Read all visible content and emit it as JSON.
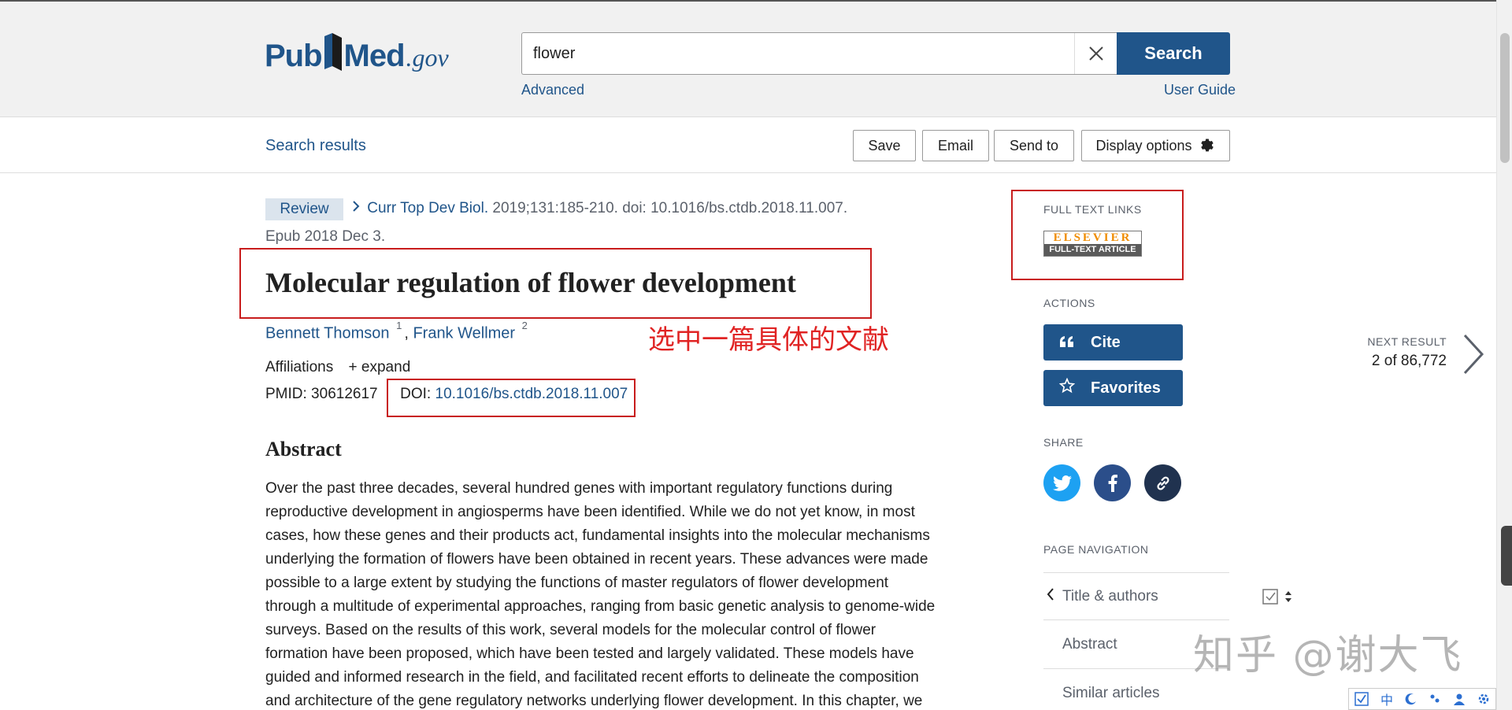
{
  "header": {
    "logo_text_pub": "Pub",
    "logo_text_med": "Med",
    "logo_text_gov": ".gov",
    "search_value": "flower",
    "search_button": "Search",
    "advanced_link": "Advanced",
    "user_guide_link": "User Guide"
  },
  "toolbar": {
    "search_results": "Search results",
    "save": "Save",
    "email": "Email",
    "send_to": "Send to",
    "display_options": "Display options"
  },
  "article": {
    "badge": "Review",
    "journal": "Curr Top Dev Biol.",
    "citation_rest": " 2019;131:185-210. doi: 10.1016/bs.ctdb.2018.11.007.",
    "epub": "Epub 2018 Dec 3.",
    "title": "Molecular regulation of flower development",
    "authors": [
      {
        "name": "Bennett Thomson",
        "aff": "1"
      },
      {
        "name": "Frank Wellmer",
        "aff": "2"
      }
    ],
    "affiliations_label": "Affiliations",
    "expand_label": "+ expand",
    "pmid_label": "PMID: 30612617",
    "doi_label": "DOI: ",
    "doi_value": "10.1016/bs.ctdb.2018.11.007",
    "abstract_heading": "Abstract",
    "abstract_lines": [
      "Over the past three decades, several hundred genes with important regulatory functions during",
      "reproductive development in angiosperms have been identified. While we do not yet know, in most",
      "cases, how these genes and their products act, fundamental insights into the molecular mechanisms",
      "underlying the formation of flowers have been obtained in recent years. These advances were made",
      "possible to a large extent by studying the functions of master regulators of flower development",
      "through a multitude of experimental approaches, ranging from basic genetic analysis to genome-wide",
      "surveys. Based on the results of this work, several models for the molecular control of flower",
      "formation have been proposed, which have been tested and largely validated. These models have",
      "guided and informed research in the field, and facilitated recent efforts to delineate the composition",
      "and architecture of the gene regulatory networks underlying flower development. In this chapter, we"
    ]
  },
  "annotation": "选中一篇具体的文献",
  "sidebar": {
    "full_text_links_label": "FULL TEXT LINKS",
    "elsevier_top": "ELSEVIER",
    "elsevier_bottom": "FULL-TEXT ARTICLE",
    "actions_label": "ACTIONS",
    "cite": "Cite",
    "favorites": "Favorites",
    "share_label": "SHARE",
    "page_nav_label": "PAGE NAVIGATION",
    "nav_items": [
      "Title & authors",
      "Abstract",
      "Similar articles"
    ]
  },
  "next_result": {
    "label": "NEXT RESULT",
    "count": "2 of 86,772"
  },
  "watermark": "知乎 @谢大飞",
  "ime": {
    "zh": "中"
  },
  "colors": {
    "brand": "#20558a",
    "annotation_red": "#c81c1c",
    "twitter": "#1da1f2",
    "facebook": "#2b4e8a"
  },
  "icons": [
    "pubmed-book-icon",
    "close-icon",
    "gear-icon",
    "chevron-right-icon",
    "quote-icon",
    "star-icon",
    "twitter-icon",
    "facebook-icon",
    "link-icon",
    "chevron-left-icon"
  ]
}
